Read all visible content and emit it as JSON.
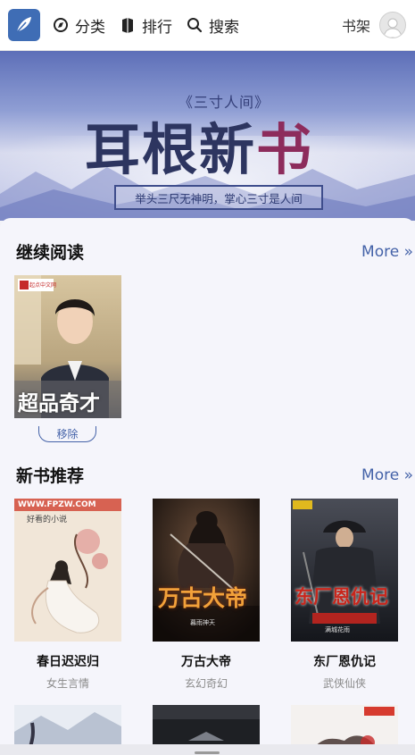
{
  "nav": {
    "items": [
      {
        "label": "分类",
        "icon": "category-icon"
      },
      {
        "label": "排行",
        "icon": "ranking-icon"
      },
      {
        "label": "搜索",
        "icon": "search-icon"
      }
    ],
    "shelf_label": "书架"
  },
  "banner": {
    "subtitle": "《三寸人间》",
    "title_main": "耳根新",
    "title_accent": "书",
    "slogan": "举头三尺无神明，掌心三寸是人间"
  },
  "continue_reading": {
    "title": "继续阅读",
    "more": "More »",
    "books": [
      {
        "cover_text": "超品奇才",
        "badge": "起点中文网"
      }
    ],
    "remove_label": "移除"
  },
  "new_books": {
    "title": "新书推荐",
    "more": "More »",
    "books": [
      {
        "name": "春日迟迟归",
        "category": "女生言情",
        "cover_text": "好看的小说",
        "site": "WWW.FPZW.COM"
      },
      {
        "name": "万古大帝",
        "category": "玄幻奇幻",
        "cover_text": "万古大帝",
        "author": "暮雨神天"
      },
      {
        "name": "东厂恩仇记",
        "category": "武侠仙侠",
        "cover_text": "东厂恩仇记",
        "author": "满城花雨"
      }
    ]
  },
  "colors": {
    "accent": "#4462a8",
    "logo_bg": "#3f6db5"
  }
}
